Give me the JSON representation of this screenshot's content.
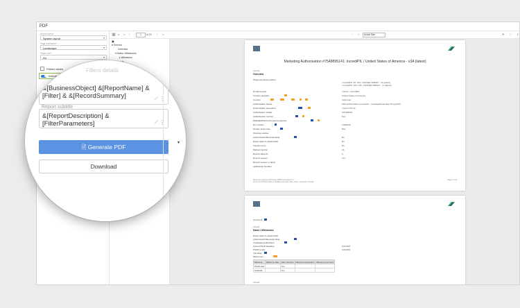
{
  "window": {
    "title": "PDF"
  },
  "left_panel": {
    "report_layout_label": "Report layout*",
    "report_layout_value": "System layout",
    "page_orientation_label": "Page orientation*",
    "page_orientation_value": "Landscape",
    "paper_size_label": "Paper size*",
    "paper_size_value": "A4",
    "flatten_tables_label": "Flatten tables",
    "include_nested_label": "Include nested"
  },
  "magnifier": {
    "section_header": "Filters details",
    "title_value": "&[BusinessObject] &[ReportName] &[Filter] & &[RecordSummary]",
    "subtitle_label": "Report subtitle",
    "subtitle_value": "&[ReportDescription] &[FilterParameters]",
    "generate_button": "Generate PDF",
    "download_button": "Download"
  },
  "tree": {
    "items": [
      "General",
      "Overview",
      "Dates / Milestones",
      "Milestones",
      "Details"
    ]
  },
  "toolbar": {
    "page_current": "1",
    "page_total": "of 23",
    "zoom_value": "Actual Size"
  },
  "document": {
    "page1_title": "Marketing Authorisation #7548895141: incrediPIL / United States of America - v3A (latest)",
    "general_label": "General",
    "overview_label": "Overview",
    "pharma_label": "Pharmaceutical product",
    "pharma_value_1": "• incrediPIL 10- N/A, COATED TABLET - v1 (latest)",
    "pharma_value_2": "• incrediPIL 100- N/A, COATED TABLET - v1 (latest)",
    "rows": [
      {
        "k": "Product name",
        "v": "Lorenz - incrediPIL"
      },
      {
        "k": "Country authority",
        "v": "United States of America"
      },
      {
        "k": "Country",
        "v": "Approved"
      },
      {
        "k": "Authorisation status",
        "v": "FDA authorisation procedure - Investigational New Drug (IND)"
      },
      {
        "k": "Authorisation procedure",
        "v": "Lorenz IVR ok"
      },
      {
        "k": "Authorisation holder",
        "v": "475488141"
      },
      {
        "k": "Authorisation number",
        "v": "N/A"
      },
      {
        "k": "EMA/MAP/NCA Procedure Number",
        "v": ""
      },
      {
        "k": "EU number",
        "v": "LORENZ"
      },
      {
        "k": "Sender local code",
        "v": "N/A"
      },
      {
        "k": "Working number",
        "v": ""
      },
      {
        "k": "Authorisation/Renewal Date",
        "v": "No"
      },
      {
        "k": "Expiry date of national MA",
        "v": "No"
      },
      {
        "k": "Inactive entry",
        "v": "No"
      },
      {
        "k": "Marked version",
        "v": "16"
      },
      {
        "k": "Record base ID",
        "v": "3"
      },
      {
        "k": "Record version",
        "v": "Yes"
      },
      {
        "k": "Record version is latest",
        "v": ""
      },
      {
        "k": "Application Number",
        "v": ""
      }
    ],
    "footer_left": "Report generated by IDS Lorenz DRS16 Regulatory 8.1\n8.0.0.0.13.2.00 (DS) 2021.07.08 Bohemian Suite, Bern, Bruce, Sergiovici, Hamzah",
    "footer_right": "Page 1 of 23",
    "page2_comment_label": "Comment",
    "page2_general": "General",
    "page2_section": "Dates / Milestones",
    "page2_rows": [
      {
        "k": "Expiry date of national MA",
        "v": ""
      },
      {
        "k": "Authorisation/Renewal Date",
        "v": ""
      },
      {
        "k": "Invalidation/withdrawn",
        "v": ""
      },
      {
        "k": "Active PSUR deadline",
        "v": "5/1/2026"
      },
      {
        "k": "PSUR expiry",
        "v": "4/1/2026"
      },
      {
        "k": "Info Date",
        "v": ""
      },
      {
        "k": "Milestones",
        "v": ""
      }
    ],
    "milestone_headers": [
      "Milestone",
      "Milestone Date",
      "Date unknown",
      "Milestone Description",
      "Milestone Comment"
    ],
    "milestone_rows": [
      [
        "PSUR start",
        "",
        "Yes",
        "",
        ""
      ],
      [
        "Initial MA",
        "",
        "Yes",
        "",
        ""
      ]
    ],
    "page2_footer": "General"
  }
}
